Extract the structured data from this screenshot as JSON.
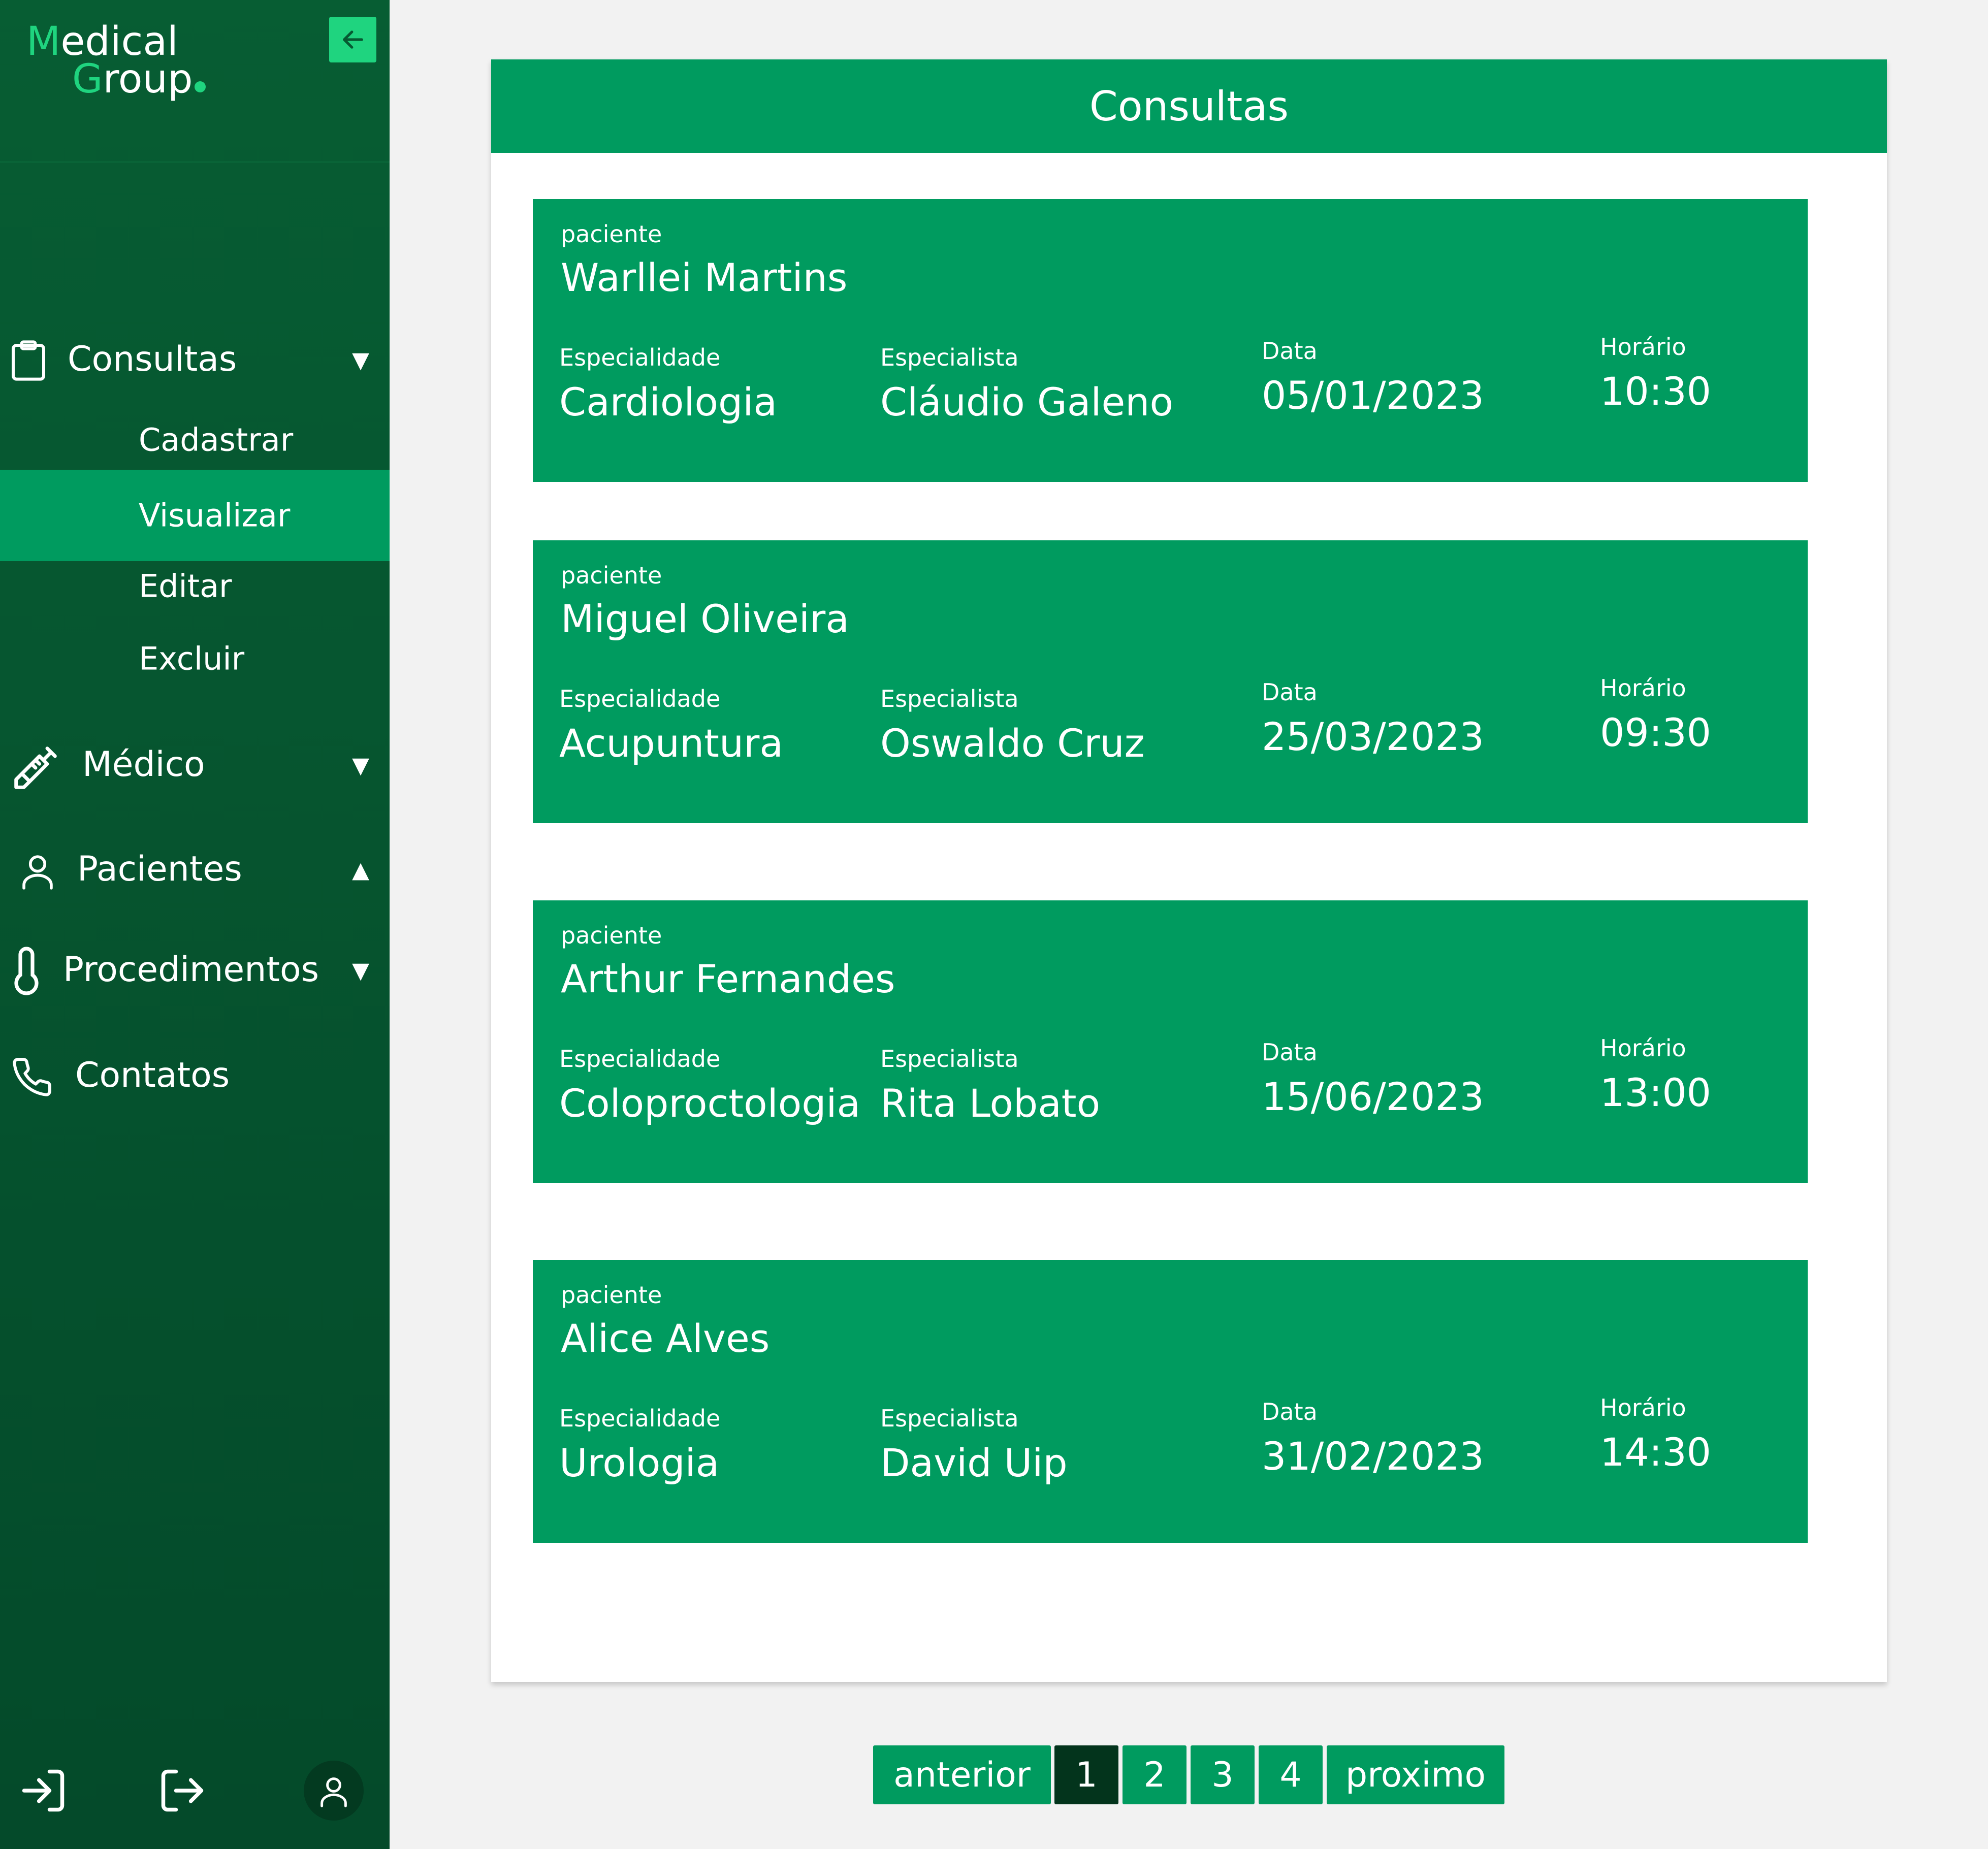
{
  "app": {
    "logo_line1_accent": "M",
    "logo_line1_rest": "edical",
    "logo_line2_accent": "G",
    "logo_line2_rest": "roup"
  },
  "colors": {
    "sidebar_bg": "#065a32",
    "accent": "#1fd47f",
    "primary_green": "#009b5f",
    "pager_active": "#03341c"
  },
  "sidebar": {
    "sections": [
      {
        "label": "Consultas",
        "icon": "clipboard-icon",
        "caret": "▼"
      },
      {
        "label": "Médico",
        "icon": "syringe-icon",
        "caret": "▼"
      },
      {
        "label": "Pacientes",
        "icon": "person-icon",
        "caret": "▲"
      },
      {
        "label": "Procedimentos",
        "icon": "thermometer-icon",
        "caret": "▼"
      },
      {
        "label": "Contatos",
        "icon": "phone-icon",
        "caret": ""
      }
    ],
    "consultas_sub": [
      "Cadastrar",
      "Visualizar",
      "Editar",
      "Excluir"
    ],
    "active_sub": "Visualizar",
    "bottom_icons": [
      "login-icon",
      "logout-icon",
      "user-avatar-icon"
    ]
  },
  "main": {
    "title": "Consultas",
    "labels": {
      "patient": "paciente",
      "specialty": "Especialidade",
      "specialist": "Especialista",
      "date": "Data",
      "time": "Horário"
    },
    "consultations": [
      {
        "patient": "Warllei Martins",
        "specialty": "Cardiologia",
        "specialist": "Cláudio Galeno",
        "date": "05/01/2023",
        "time": "10:30"
      },
      {
        "patient": "Miguel Oliveira",
        "specialty": "Acupuntura",
        "specialist": "Oswaldo Cruz",
        "date": "25/03/2023",
        "time": "09:30"
      },
      {
        "patient": "Arthur Fernandes",
        "specialty": "Coloproctologia",
        "specialist": "Rita Lobato",
        "date": "15/06/2023",
        "time": "13:00"
      },
      {
        "patient": "Alice Alves",
        "specialty": "Urologia",
        "specialist": "David Uip",
        "date": "31/02/2023",
        "time": "14:30"
      }
    ]
  },
  "pagination": {
    "prev": "anterior",
    "pages": [
      "1",
      "2",
      "3",
      "4"
    ],
    "current": "1",
    "next": "proximo"
  }
}
